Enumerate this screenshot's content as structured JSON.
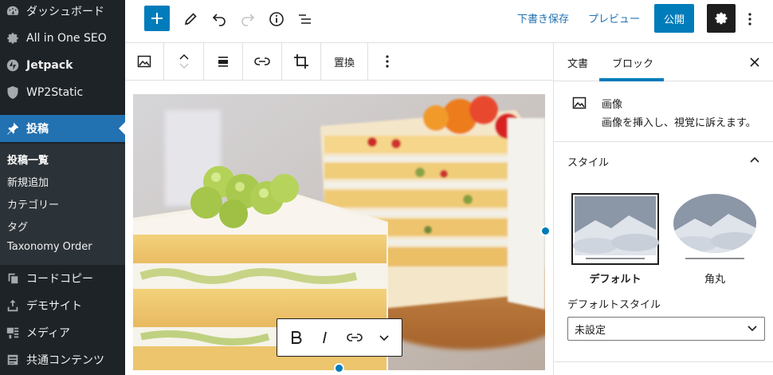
{
  "sidebar": {
    "items": [
      {
        "label": "ダッシュボード",
        "icon": "dashboard-icon"
      },
      {
        "label": "All in One SEO",
        "icon": "gear-icon"
      },
      {
        "label": "Jetpack",
        "icon": "jetpack-icon"
      },
      {
        "label": "WP2Static",
        "icon": "shield-icon"
      },
      {
        "label": "投稿",
        "icon": "pin-icon"
      },
      {
        "label": "コードコピー",
        "icon": "copy-icon"
      },
      {
        "label": "デモサイト",
        "icon": "upload-icon"
      },
      {
        "label": "メディア",
        "icon": "media-icon"
      },
      {
        "label": "共通コンテンツ",
        "icon": "list-icon"
      }
    ],
    "submenu": [
      "投稿一覧",
      "新規追加",
      "カテゴリー",
      "タグ",
      "Taxonomy Order"
    ]
  },
  "header": {
    "save_draft": "下書き保存",
    "preview": "プレビュー",
    "publish": "公開"
  },
  "toolbar": {
    "replace": "置換"
  },
  "settings": {
    "tabs": [
      "文書",
      "ブロック"
    ],
    "block_name": "画像",
    "block_description": "画像を挿入し、視覚に訴えます。",
    "style_title": "スタイル",
    "styles": [
      "デフォルト",
      "角丸"
    ],
    "default_style_label": "デフォルトスタイル",
    "default_style_value": "未設定"
  },
  "colors": {
    "admin_bg": "#1d2327",
    "accent": "#007cba"
  }
}
